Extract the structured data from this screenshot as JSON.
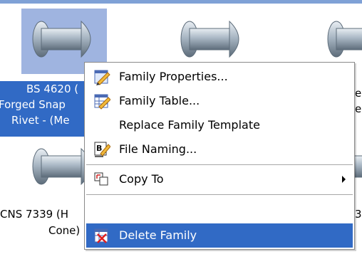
{
  "window": {
    "accent": "#316ac5"
  },
  "items": [
    {
      "caption_lines": [
        "BS 4620 (",
        "Forged Snap",
        "Rivet - (Me"
      ],
      "selected": true
    },
    {
      "caption_lines": [
        "CNS 7339 (H",
        "Cone)"
      ],
      "selected": false
    }
  ],
  "partial_captions": [
    "e",
    "e",
    "3"
  ],
  "context_menu": {
    "items": [
      {
        "label": "Family Properties...",
        "icon": "family-properties-icon"
      },
      {
        "label": "Family Table...",
        "icon": "family-table-icon"
      },
      {
        "label": "Replace Family Template",
        "icon": ""
      },
      {
        "label": "File Naming...",
        "icon": "file-naming-icon"
      },
      {
        "label": "Copy To",
        "icon": "copy-to-icon",
        "submenu": true
      },
      {
        "label": "Delete Family",
        "icon": "delete-family-icon",
        "highlighted": true
      }
    ]
  }
}
